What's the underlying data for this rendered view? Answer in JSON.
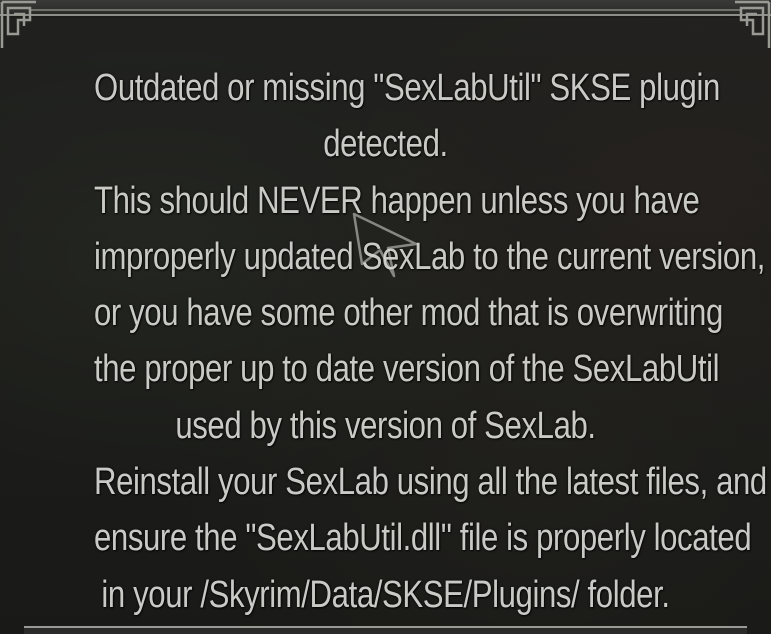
{
  "dialog": {
    "lines": [
      "Outdated or missing \"SexLabUtil\" SKSE plugin",
      "detected.",
      "This should NEVER happen unless you have",
      "improperly updated SexLab to the current version,",
      "or you have some other mod that is overwriting",
      "the proper up to date version of the SexLabUtil",
      "used by this version of SexLab.",
      "Reinstall your SexLab using all the latest files, and",
      "ensure the \"SexLabUtil.dll\" file is properly located",
      "in your /Skyrim/Data/SKSE/Plugins/ folder."
    ]
  },
  "colors": {
    "text": "#c9c9c5",
    "frame": "#8d8d88",
    "background": "#252622"
  },
  "icons": {
    "cursor": "mouse-cursor-icon",
    "corner": "knotwork-corner-icon"
  }
}
